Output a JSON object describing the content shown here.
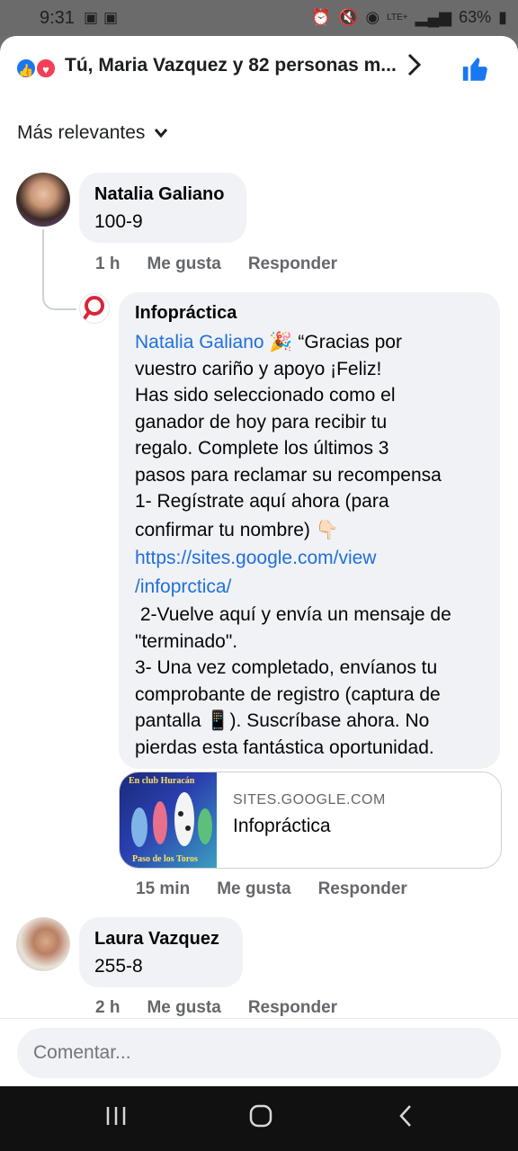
{
  "status": {
    "time": "9:31",
    "battery": "63%",
    "network": "LTE+"
  },
  "reactions": {
    "summary": "Tú, Maria Vazquez y 82 personas m...",
    "icons": [
      "like-icon",
      "love-icon"
    ]
  },
  "sort": {
    "label": "Más relevantes"
  },
  "comments": [
    {
      "author": "Natalia Galiano",
      "text": "100-9",
      "time": "1 h",
      "like": "Me gusta",
      "reply": "Responder"
    },
    {
      "author": "Infopráctica",
      "mention": "Natalia Galiano",
      "lines": [
        "vuestro cariño y apoyo ¡Feliz!",
        "Has sido seleccionado como el",
        "ganador de hoy para recibir tu",
        "regalo. Complete los últimos 3",
        "pasos para reclamar su recompensa",
        "1- Regístrate aquí ahora (para"
      ],
      "line_after_mention": " 🎉 “Gracias por",
      "line_confirm": "confirmar tu nombre) 👇🏻",
      "url_line1": "https://sites.google.com/view",
      "url_line2": "/infoprctica/",
      "lines2": [
        " 2-Vuelve aquí y envía un mensaje de",
        "\"terminado\".",
        "3- Una vez completado, envíanos tu",
        "comprobante de registro (captura de",
        "pantalla 📱). Suscríbase ahora. No",
        "pierdas esta fantástica oportunidad."
      ],
      "link_card": {
        "domain": "SITES.GOOGLE.COM",
        "title": "Infopráctica",
        "thumb_top": "En club Huracán",
        "thumb_bottom": "Paso de los Toros"
      },
      "time": "15 min",
      "like": "Me gusta",
      "reply": "Responder"
    },
    {
      "author": "Laura Vazquez",
      "text": "255-8",
      "time": "2 h",
      "like": "Me gusta",
      "reply": "Responder"
    }
  ],
  "composer": {
    "placeholder": "Comentar..."
  },
  "colors": {
    "accent": "#1877f2",
    "link": "#216fdb",
    "bubble": "#f0f2f5",
    "meta": "#65676b"
  }
}
